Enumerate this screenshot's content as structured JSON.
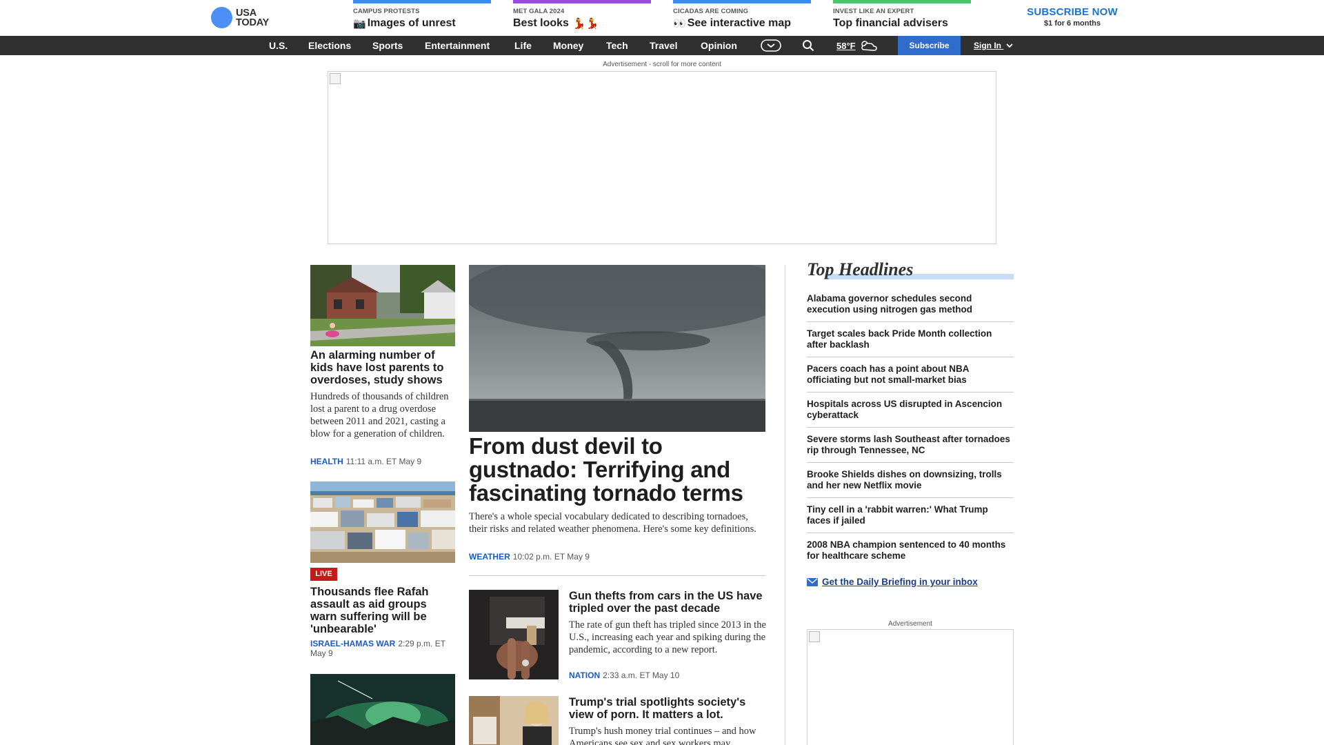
{
  "brand": {
    "line1": "USA",
    "line2": "TODAY"
  },
  "promos": [
    {
      "kicker": "CAMPUS PROTESTS",
      "title": "Images of unrest",
      "emoji": "📷",
      "color": "#3d8cf0"
    },
    {
      "kicker": "MET GALA 2024",
      "title": "Best looks",
      "emoji": "💃💃",
      "color": "#9a4ee0"
    },
    {
      "kicker": "CICADAS ARE COMING",
      "title": "See interactive map",
      "emoji": "👀",
      "color": "#3d8cf0"
    },
    {
      "kicker": "INVEST LIKE AN EXPERT",
      "title": "Top financial advisers",
      "emoji": "",
      "color": "#4fc36a"
    }
  ],
  "subscribe_cta": {
    "label": "SUBSCRIBE NOW",
    "offer": "$1 for 6 months"
  },
  "nav": {
    "items": [
      "U.S.",
      "Elections",
      "Sports",
      "Entertainment",
      "Life",
      "Money",
      "Tech",
      "Travel",
      "Opinion"
    ],
    "weather": "58°F",
    "subscribe": "Subscribe",
    "signin": "Sign In"
  },
  "ad_top": {
    "label": "Advertisement - scroll for more content"
  },
  "left_stories": [
    {
      "title": "An alarming number of kids have lost parents to overdoses, study shows",
      "summary": "Hundreds of thousands of children lost a parent to a drug overdose between 2011 and 2021, casting a blow for a generation of children.",
      "section": "HEALTH",
      "time": "11:11 a.m. ET May 9"
    },
    {
      "badge": "LIVE",
      "title": "Thousands flee Rafah assault as aid groups warn suffering will be 'unbearable'",
      "section": "ISRAEL-HAMAS WAR",
      "time": "2:29 p.m. ET May 9"
    }
  ],
  "main_story": {
    "title": "From dust devil to gustnado: Terrifying and fascinating tornado terms",
    "summary": "There's a whole special vocabulary dedicated to describing tornadoes, their risks and related weather phenomena. Here's some key definitions.",
    "section": "WEATHER",
    "time": "10:02 p.m. ET May 9"
  },
  "secondary_stories": [
    {
      "title": "Gun thefts from cars in the US have tripled over the past decade",
      "summary": "The rate of gun theft has tripled since 2013 in the U.S., increasing each year and spiking during the pandemic, according to a new report.",
      "section": "NATION",
      "time": "2:33 a.m. ET May 10"
    },
    {
      "title": "Trump's trial spotlights society's view of porn. It matters a lot.",
      "summary": "Trump's hush money trial continues – and how Americans see sex and sex workers may"
    }
  ],
  "top_headlines": {
    "title": "Top Headlines",
    "items": [
      "Alabama governor schedules second execution using nitrogen gas method",
      "Target scales back Pride Month collection after backlash",
      "Pacers coach has a point about NBA officiating but not small-market bias",
      "Hospitals across US disrupted in Ascencion cyberattack",
      "Severe storms lash Southeast after tornadoes rip through Tennessee, NC",
      "Brooke Shields dishes on downsizing, trolls and her new Netflix movie",
      "Tiny cell in a 'rabbit warren:' What Trump faces if jailed",
      "2008 NBA champion sentenced to 40 months for healthcare scheme"
    ],
    "newsletter": "Get the Daily Briefing in your inbox"
  },
  "ad_side": {
    "label": "Advertisement"
  }
}
